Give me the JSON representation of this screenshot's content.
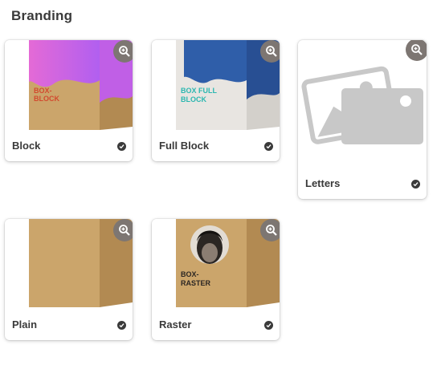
{
  "section": {
    "title": "Branding"
  },
  "options": [
    {
      "label": "Block",
      "thumb_text": "BOX-BLOCK"
    },
    {
      "label": "Full Block",
      "thumb_text": "BOX FULL BLOCK"
    },
    {
      "label": "Letters"
    },
    {
      "label": "Plain"
    },
    {
      "label": "Raster",
      "thumb_text": "BOX-RASTER"
    }
  ],
  "icons": {
    "zoom": "zoom-in-icon",
    "selected": "check-circle-icon",
    "placeholder": "image-placeholder-icon"
  },
  "colors": {
    "text": "#3a3a3a",
    "zoom_bg": "#7d7672",
    "cardboard": "#c9a46a",
    "placeholder": "#c8c8c8"
  }
}
